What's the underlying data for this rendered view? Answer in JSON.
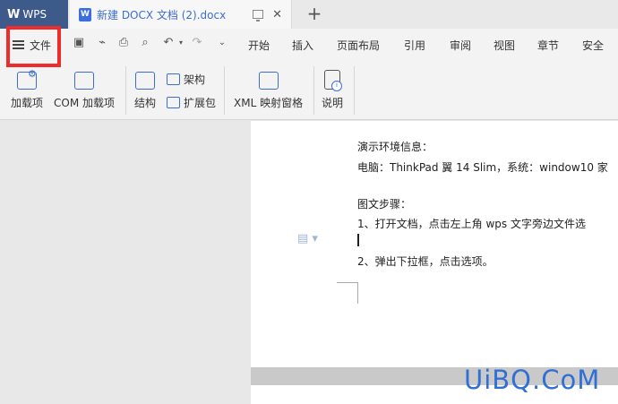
{
  "titlebar": {
    "app_name": "WPS",
    "doc_tab_title": "新建 DOCX 文档 (2).docx",
    "close_glyph": "✕",
    "new_tab_glyph": "+"
  },
  "menubar": {
    "file_label": "文件",
    "tabs": [
      "开始",
      "插入",
      "页面布局",
      "引用",
      "审阅",
      "视图",
      "章节",
      "安全"
    ]
  },
  "ribbon": {
    "addins_label": "加载项",
    "com_addins_label": "COM 加载项",
    "structure_label": "结构",
    "schema_label": "架构",
    "expansion_pack_label": "扩展包",
    "xml_mapping_label": "XML 映射窗格",
    "help_label": "说明"
  },
  "document": {
    "lines": [
      "演示环境信息：",
      "电脑：ThinkPad 翼 14 Slim，系统：window10 家",
      "图文步骤：",
      "1、打开文档，点击左上角 wps 文字旁边文件选",
      "2、弹出下拉框，点击选项。"
    ]
  },
  "watermark": "UiBQ.CoM",
  "colors": {
    "wps_tab_bg": "#3d5a8a",
    "highlight_box": "#ee2c2c",
    "accent": "#3d6ecf"
  }
}
